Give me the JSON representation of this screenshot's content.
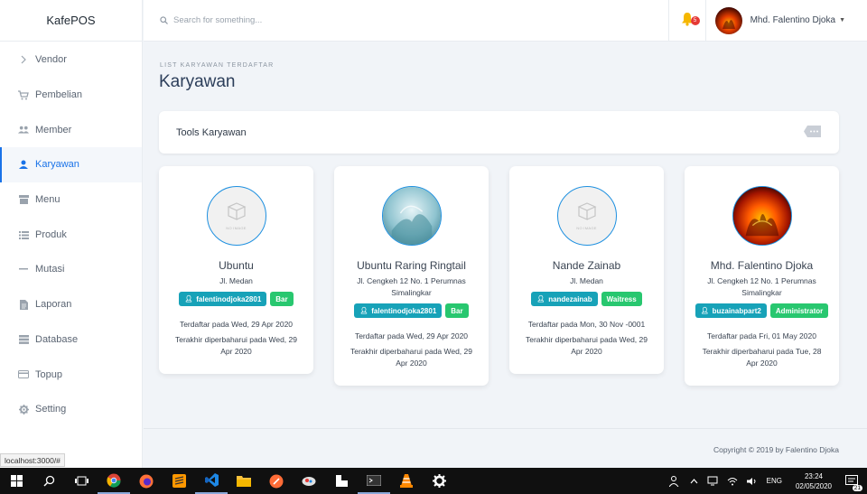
{
  "app": {
    "brand": "KafePOS"
  },
  "sidebar": {
    "items": [
      {
        "label": "Vendor",
        "icon": "chevron-right-icon"
      },
      {
        "label": "Pembelian",
        "icon": "cart-icon"
      },
      {
        "label": "Member",
        "icon": "users-icon"
      },
      {
        "label": "Karyawan",
        "icon": "user-icon",
        "active": true
      },
      {
        "label": "Menu",
        "icon": "menu-icon"
      },
      {
        "label": "Produk",
        "icon": "list-icon"
      },
      {
        "label": "Mutasi",
        "icon": "minus-icon"
      },
      {
        "label": "Laporan",
        "icon": "document-icon"
      },
      {
        "label": "Database",
        "icon": "database-icon"
      },
      {
        "label": "Topup",
        "icon": "card-icon"
      },
      {
        "label": "Setting",
        "icon": "gear-icon"
      }
    ]
  },
  "header": {
    "search_placeholder": "Search for something...",
    "notification_count": "5",
    "user_name": "Mhd. Falentino Djoka"
  },
  "page": {
    "subtitle": "LIST KARYAWAN TERDAFTAR",
    "title": "Karyawan",
    "tools_title": "Tools Karyawan"
  },
  "employees": [
    {
      "name": "Ubuntu",
      "address": "Jl. Medan",
      "username": "falentinodjoka2801",
      "role": "Bar",
      "photo": "no-image",
      "registered": "Terdaftar pada Wed, 29 Apr 2020",
      "updated": "Terakhir diperbaharui pada Wed, 29 Apr 2020"
    },
    {
      "name": "Ubuntu Raring Ringtail",
      "address": "Jl. Cengkeh 12 No. 1 Perumnas Simalingkar",
      "username": "falentinodjoka2801",
      "role": "Bar",
      "photo": "ringtail",
      "registered": "Terdaftar pada Wed, 29 Apr 2020",
      "updated": "Terakhir diperbaharui pada Wed, 29 Apr 2020"
    },
    {
      "name": "Nande Zainab",
      "address": "Jl. Medan",
      "username": "nandezainab",
      "role": "Waitress",
      "photo": "no-image",
      "registered": "Terdaftar pada Mon, 30 Nov -0001",
      "updated": "Terakhir diperbaharui pada Wed, 29 Apr 2020"
    },
    {
      "name": "Mhd. Falentino Djoka",
      "address": "Jl. Cengkeh 12 No. 1 Perumnas Simalingkar",
      "username": "buzainabpart2",
      "role": "Administrator",
      "photo": "fire",
      "registered": "Terdaftar pada Fri, 01 May 2020",
      "updated": "Terakhir diperbaharui pada Tue, 28 Apr 2020"
    }
  ],
  "no_image_text": "NO IMAGE",
  "footer": {
    "copyright": "Copyright © 2019 by Falentino Djoka"
  },
  "status_url": "localhost:3000/#",
  "taskbar": {
    "lang": "ENG",
    "time": "23:24",
    "date": "02/05/2020",
    "notif_count": "21"
  },
  "colors": {
    "accent": "#1a73e8",
    "user_tag": "#17a2b8",
    "role_tag": "#28c76f",
    "badge": "#e53935"
  }
}
